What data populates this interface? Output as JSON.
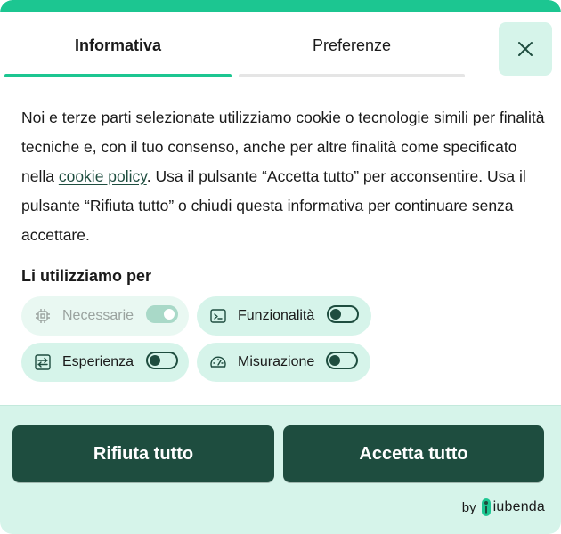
{
  "tabs": {
    "informativa": "Informativa",
    "preferenze": "Preferenze"
  },
  "close": {
    "icon": "close-icon"
  },
  "body": {
    "text_before_link": "Noi e terze parti selezionate utilizziamo cookie o tecnologie simili per finalità tecniche e, con il tuo consenso, anche per altre finalità come specificato nella ",
    "link_text": "cookie policy",
    "text_after_link": ". Usa il pulsante “Accetta tutto” per acconsentire. Usa il pulsante “Rifiuta tutto” o chiudi questa informativa per continuare senza accettare."
  },
  "purposes": {
    "title": "Li utilizziamo per",
    "items": [
      {
        "label": "Necessarie",
        "icon": "chip-icon",
        "enabled": true,
        "locked": true
      },
      {
        "label": "Funzionalità",
        "icon": "terminal-icon",
        "enabled": false,
        "locked": false
      },
      {
        "label": "Esperienza",
        "icon": "swap-icon",
        "enabled": false,
        "locked": false
      },
      {
        "label": "Misurazione",
        "icon": "gauge-icon",
        "enabled": false,
        "locked": false
      }
    ]
  },
  "actions": {
    "reject": "Rifiuta tutto",
    "accept": "Accetta tutto"
  },
  "brand": {
    "by": "by",
    "name": "iubenda"
  },
  "colors": {
    "accent": "#1cc691",
    "primary_dark": "#1e4d3f",
    "chip_bg": "#d6f4ea",
    "footer_bg": "#d6f4ea"
  }
}
